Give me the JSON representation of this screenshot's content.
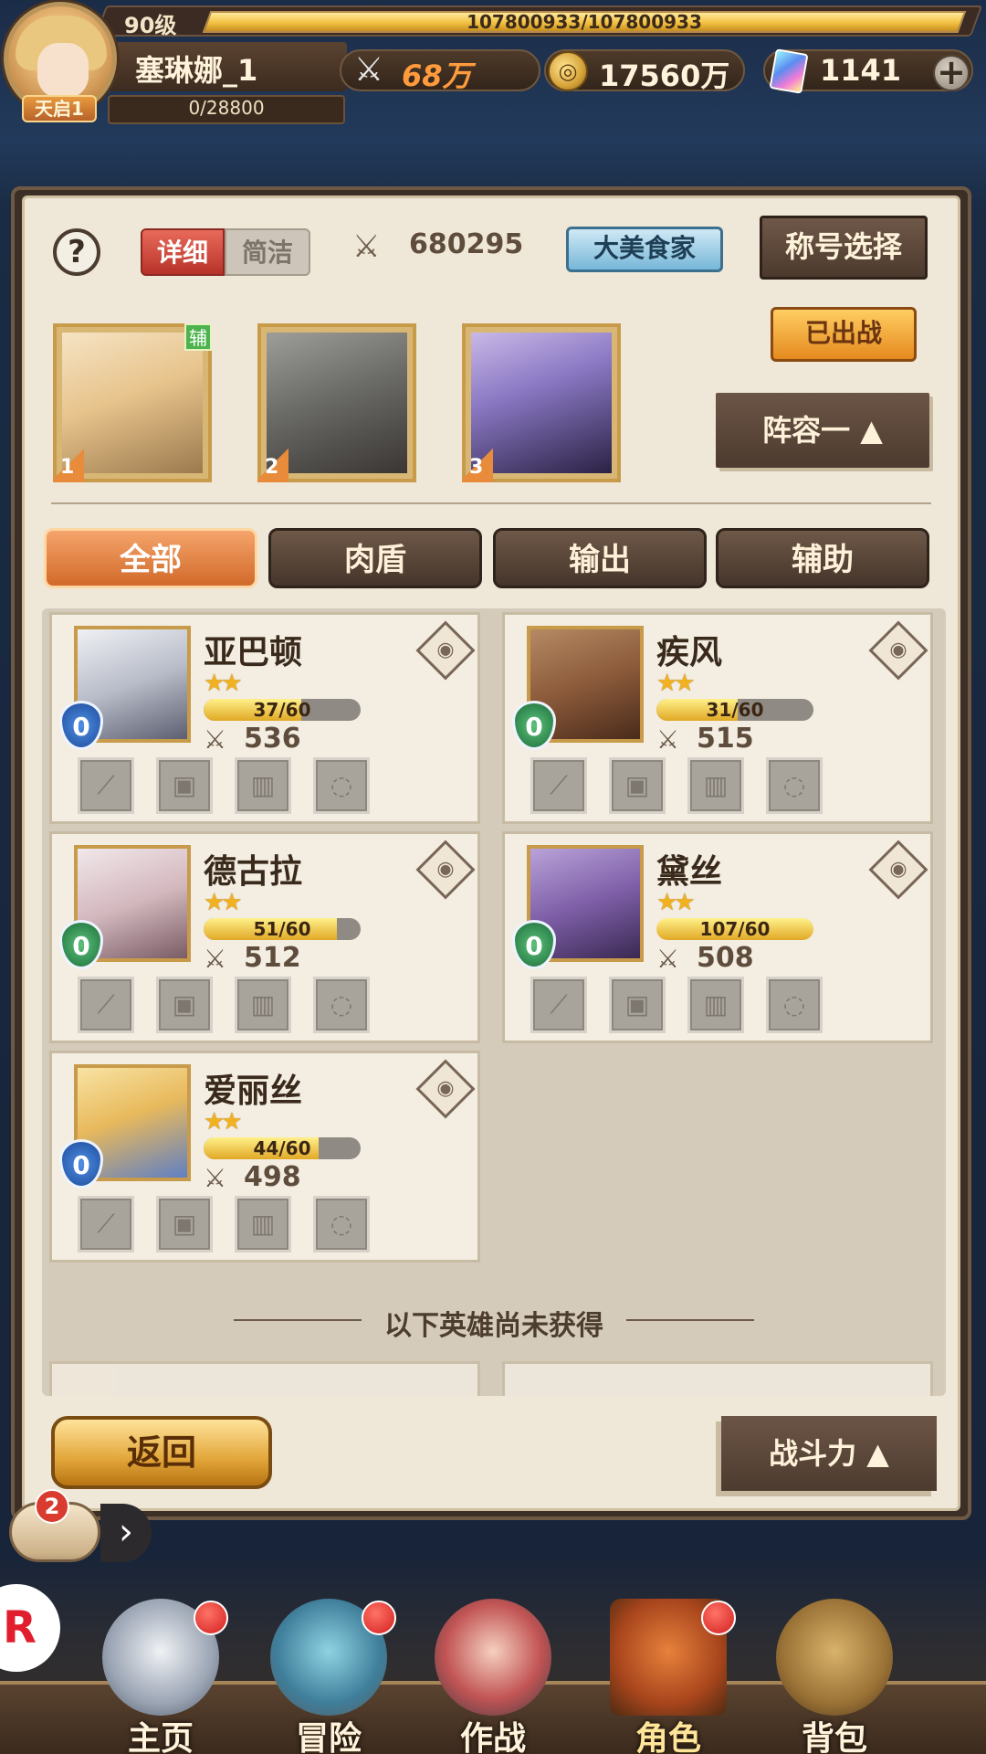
{
  "player": {
    "level": "90级",
    "name": "塞琳娜_1",
    "vip": "天启1",
    "exp_text": "107800933/107800933",
    "exp_fraction": 1.0,
    "stamina_text": "0/28800"
  },
  "resources": {
    "power": "68万",
    "gold": "17560万",
    "gems": "1141",
    "plus": "+"
  },
  "panel": {
    "help": "?",
    "mode_detail": "详细",
    "mode_brief": "简洁",
    "total_power": "680295",
    "title_badge": "大美食家",
    "title_select": "称号选择",
    "deployed": "已出战",
    "lineup": "阵容一 ▲"
  },
  "team": [
    {
      "slot": "1",
      "tag": "辅"
    },
    {
      "slot": "2",
      "tag": ""
    },
    {
      "slot": "3",
      "tag": ""
    }
  ],
  "filters": [
    "全部",
    "肉盾",
    "输出",
    "辅助"
  ],
  "heroes": [
    {
      "name": "亚巴顿",
      "stars": "★★",
      "shards": "37/60",
      "shard_fraction": 0.62,
      "power": "536",
      "rank": "0",
      "rank_color": "blue"
    },
    {
      "name": "疾风",
      "stars": "★★",
      "shards": "31/60",
      "shard_fraction": 0.52,
      "power": "515",
      "rank": "0",
      "rank_color": "green"
    },
    {
      "name": "德古拉",
      "stars": "★★",
      "shards": "51/60",
      "shard_fraction": 0.85,
      "power": "512",
      "rank": "0",
      "rank_color": "green"
    },
    {
      "name": "黛丝",
      "stars": "★★",
      "shards": "107/60",
      "shard_fraction": 1.0,
      "power": "508",
      "rank": "0",
      "rank_color": "green"
    },
    {
      "name": "爱丽丝",
      "stars": "★★",
      "shards": "44/60",
      "shard_fraction": 0.73,
      "power": "498",
      "rank": "0",
      "rank_color": "blue"
    }
  ],
  "locked_banner": "以下英雄尚未获得",
  "buttons": {
    "back": "返回",
    "sort": "战斗力 ▲"
  },
  "chat": {
    "count": "2",
    "arrow": "›"
  },
  "nav": [
    {
      "label": "主页",
      "has_dot": true
    },
    {
      "label": "冒险",
      "has_dot": true
    },
    {
      "label": "作战",
      "has_dot": false
    },
    {
      "label": "角色",
      "has_dot": true
    },
    {
      "label": "背包",
      "has_dot": false
    }
  ],
  "colors": {
    "accent": "#d16a2a",
    "gold_bar": "#f2c142",
    "red_dot": "#d21f1f"
  }
}
